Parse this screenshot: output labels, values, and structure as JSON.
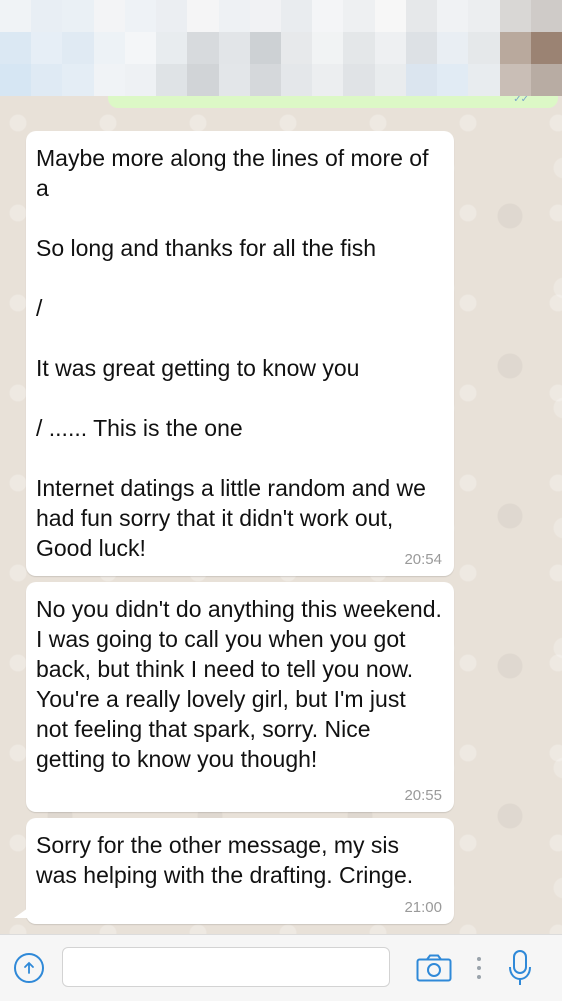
{
  "header": {
    "pixels": [
      "#f0f3f6",
      "#e8eef4",
      "#eaf0f5",
      "#f3f4f6",
      "#eef2f6",
      "#ebeef2",
      "#f5f5f6",
      "#eef1f4",
      "#f1f2f4",
      "#e9ecef",
      "#f4f5f7",
      "#eef0f2",
      "#f7f7f7",
      "#e6e8ea",
      "#f0f2f4",
      "#eceef0",
      "#d9d7d5",
      "#cfcbc8",
      "#dbe8f3",
      "#e6eef6",
      "#e0eaf3",
      "#edf2f6",
      "#f4f6f8",
      "#e8ecef",
      "#d7dadd",
      "#e2e5e8",
      "#cdd1d4",
      "#e7e9eb",
      "#f1f3f4",
      "#e4e7e9",
      "#eef0f2",
      "#dde1e5",
      "#e9eef3",
      "#e5e8ea",
      "#b9a99d",
      "#9b8373",
      "#d6e6f3",
      "#dfeaf4",
      "#e4edf5",
      "#f0f3f6",
      "#eef1f4",
      "#dfe3e6",
      "#d1d4d7",
      "#e3e6e9",
      "#d5d8db",
      "#e4e7ea",
      "#eceef0",
      "#e0e3e6",
      "#e9ecee",
      "#dbe5ef",
      "#e1ebf4",
      "#e8ecef",
      "#c9beb6",
      "#b8aca3"
    ]
  },
  "chat": {
    "outgoing_ticks": "✓✓",
    "messages": [
      {
        "text": "Maybe more along the lines of more of a\n\nSo long and thanks for all the fish\n\n/\n\nIt was great getting to know you\n\n/ ...... This is the one\n\nInternet datings a little random and we had fun sorry that it didn't work out, Good luck!",
        "time": "20:54"
      },
      {
        "text": "No you didn't do anything this weekend. I was going to call you when you got back, but think I need to tell you now. You're a really lovely girl, but I'm just not feeling that spark, sorry. Nice getting to know you though!",
        "time": "20:55"
      },
      {
        "text": "Sorry for the other message, my sis was helping with the drafting. Cringe.",
        "time": "21:00"
      }
    ]
  },
  "input_bar": {
    "plus_icon": "plus-circle-icon",
    "camera_icon": "camera-icon",
    "mic_icon": "microphone-icon",
    "accent": "#2f89d8"
  }
}
